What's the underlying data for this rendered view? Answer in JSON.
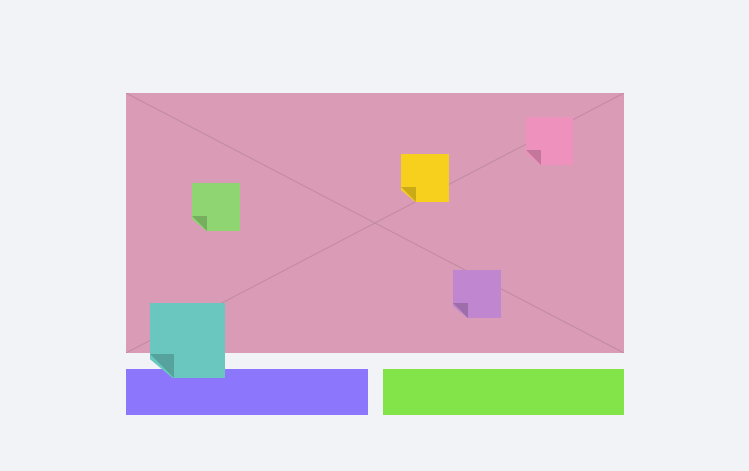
{
  "canvas": {
    "background": "#d99bb6",
    "line_color": "#c08aa1"
  },
  "notes": [
    {
      "name": "sticky-note-green",
      "color": "#8fd672"
    },
    {
      "name": "sticky-note-yellow",
      "color": "#f7d01d"
    },
    {
      "name": "sticky-note-pink",
      "color": "#ee92bd"
    },
    {
      "name": "sticky-note-purple",
      "color": "#c087d0"
    },
    {
      "name": "sticky-note-teal",
      "color": "#69c7c0"
    }
  ],
  "bars": [
    {
      "name": "purple-bar",
      "color": "#8c76fb"
    },
    {
      "name": "green-bar",
      "color": "#82e448"
    }
  ]
}
